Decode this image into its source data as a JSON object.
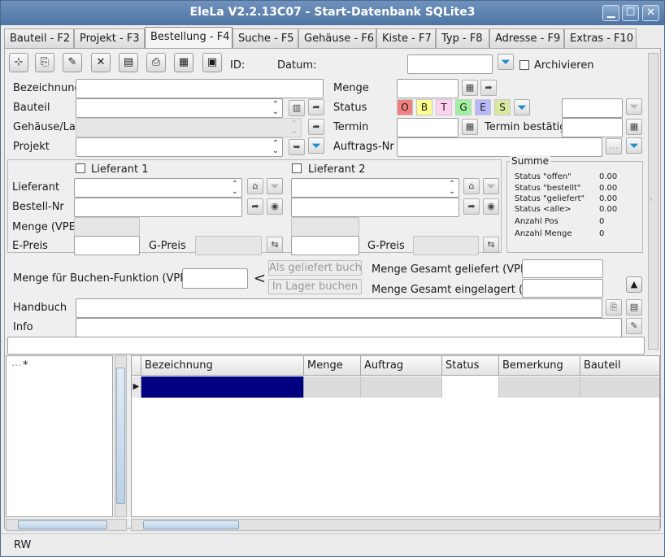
{
  "window": {
    "title": "EleLa V2.2.13C07  - Start-Datenbank SQLite3"
  },
  "tabs": [
    {
      "label": "Bauteil - F2"
    },
    {
      "label": "Projekt - F3"
    },
    {
      "label": "Bestellung - F4"
    },
    {
      "label": "Suche - F5"
    },
    {
      "label": "Gehäuse - F6"
    },
    {
      "label": "Kiste - F7"
    },
    {
      "label": "Typ - F8"
    },
    {
      "label": "Adresse - F9"
    },
    {
      "label": "Extras - F10"
    }
  ],
  "active_tab": "Bestellung - F4",
  "header": {
    "id_label": "ID:",
    "datum_label": "Datum:",
    "archivieren_label": "Archivieren",
    "archivieren_checked": false
  },
  "fields": {
    "bezeichnung": "Bezeichnung",
    "bauteil": "Bauteil",
    "gehaeuse": "Gehäuse/Lag",
    "projekt": "Projekt",
    "menge": "Menge",
    "status": "Status",
    "termin": "Termin",
    "termin_bestaetigt": "Termin bestätigt",
    "auftrags_nr": "Auftrags-Nr"
  },
  "status_buttons": [
    {
      "letter": "O",
      "color": "#f08080"
    },
    {
      "letter": "B",
      "color": "#ffff90"
    },
    {
      "letter": "T",
      "color": "#ffd0f0"
    },
    {
      "letter": "G",
      "color": "#a0f0a0"
    },
    {
      "letter": "E",
      "color": "#b8b8f8"
    },
    {
      "letter": "S",
      "color": "#d8e8a0"
    }
  ],
  "lieferant": {
    "l1_label": "Lieferant 1",
    "l2_label": "Lieferant 2",
    "lieferant": "Lieferant",
    "bestell_nr": "Bestell-Nr",
    "menge_vpe": "Menge (VPE)",
    "e_preis": "E-Preis",
    "g_preis": "G-Preis"
  },
  "summe": {
    "title": "Summe",
    "rows": [
      {
        "label": "Status \"offen\"",
        "value": "0.00"
      },
      {
        "label": "Status \"bestellt\"",
        "value": "0.00"
      },
      {
        "label": "Status \"geliefert\"",
        "value": "0.00"
      },
      {
        "label": "Status <alle>",
        "value": "0.00"
      },
      {
        "label": "Anzahl Pos",
        "value": "0"
      },
      {
        "label": "Anzahl Menge",
        "value": "0"
      }
    ]
  },
  "buchen": {
    "menge_label": "Menge für Buchen-Funktion (VPE)",
    "lt": "<",
    "als_geliefert": "Als geliefert buchen",
    "in_lager": "In Lager buchen",
    "gesamt_geliefert": "Menge Gesamt geliefert (VPE)",
    "gesamt_eingelagert": "Menge Gesamt eingelagert (VPE)"
  },
  "handbuch_label": "Handbuch",
  "info_label": "Info",
  "tree": {
    "root": "*"
  },
  "grid": {
    "columns": [
      "Bezeichnung",
      "Menge",
      "Auftrag",
      "Status",
      "Bemerkung",
      "Bauteil"
    ]
  },
  "statusbar": {
    "text": "RW"
  }
}
